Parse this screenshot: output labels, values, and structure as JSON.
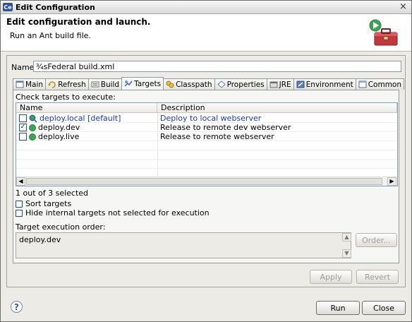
{
  "window": {
    "app_icon_text": "Ce",
    "title": "Edit Configuration",
    "close_glyph": "×"
  },
  "header": {
    "title": "Edit configuration and launch.",
    "subtitle": "Run an Ant build file.",
    "banner_icon": "toolbox-run-icon"
  },
  "name_field": {
    "label": "Name:",
    "value": "¾sFederal build.xml"
  },
  "tabs": [
    {
      "label": "Main",
      "icon": "main-icon",
      "active": false
    },
    {
      "label": "Refresh",
      "icon": "refresh-icon",
      "active": false
    },
    {
      "label": "Build",
      "icon": "build-icon",
      "active": false
    },
    {
      "label": "Targets",
      "icon": "targets-icon",
      "active": true
    },
    {
      "label": "Classpath",
      "icon": "classpath-icon",
      "active": false
    },
    {
      "label": "Properties",
      "icon": "properties-icon",
      "active": false
    },
    {
      "label": "JRE",
      "icon": "jre-icon",
      "active": false
    },
    {
      "label": "Environment",
      "icon": "environment-icon",
      "active": false
    },
    {
      "label": "Common",
      "icon": "common-icon",
      "active": false
    }
  ],
  "targets": {
    "check_label": "Check targets to execute:",
    "columns": [
      "Name",
      "Description"
    ],
    "rows": [
      {
        "name": "deploy.local [default]",
        "description": "Deploy to local webserver",
        "checked": false,
        "is_default": true
      },
      {
        "name": "deploy.dev",
        "description": "Release to remote dev webserver",
        "checked": true,
        "is_default": false
      },
      {
        "name": "deploy.live",
        "description": "Release to remote webserver",
        "checked": false,
        "is_default": false
      }
    ],
    "selected_count": "1 out of 3 selected",
    "sort_targets_label": "Sort targets",
    "sort_targets_checked": false,
    "hide_internal_label": "Hide internal targets not selected for execution",
    "hide_internal_checked": false,
    "order_label": "Target execution order:",
    "order_value": "deploy.dev",
    "order_button": "Order..."
  },
  "buttons": {
    "apply": "Apply",
    "revert": "Revert",
    "run": "Run",
    "close": "Close",
    "help": "?"
  },
  "colors": {
    "default_target_text": "#1a35d6",
    "target_icon_green": "#3aa552"
  }
}
